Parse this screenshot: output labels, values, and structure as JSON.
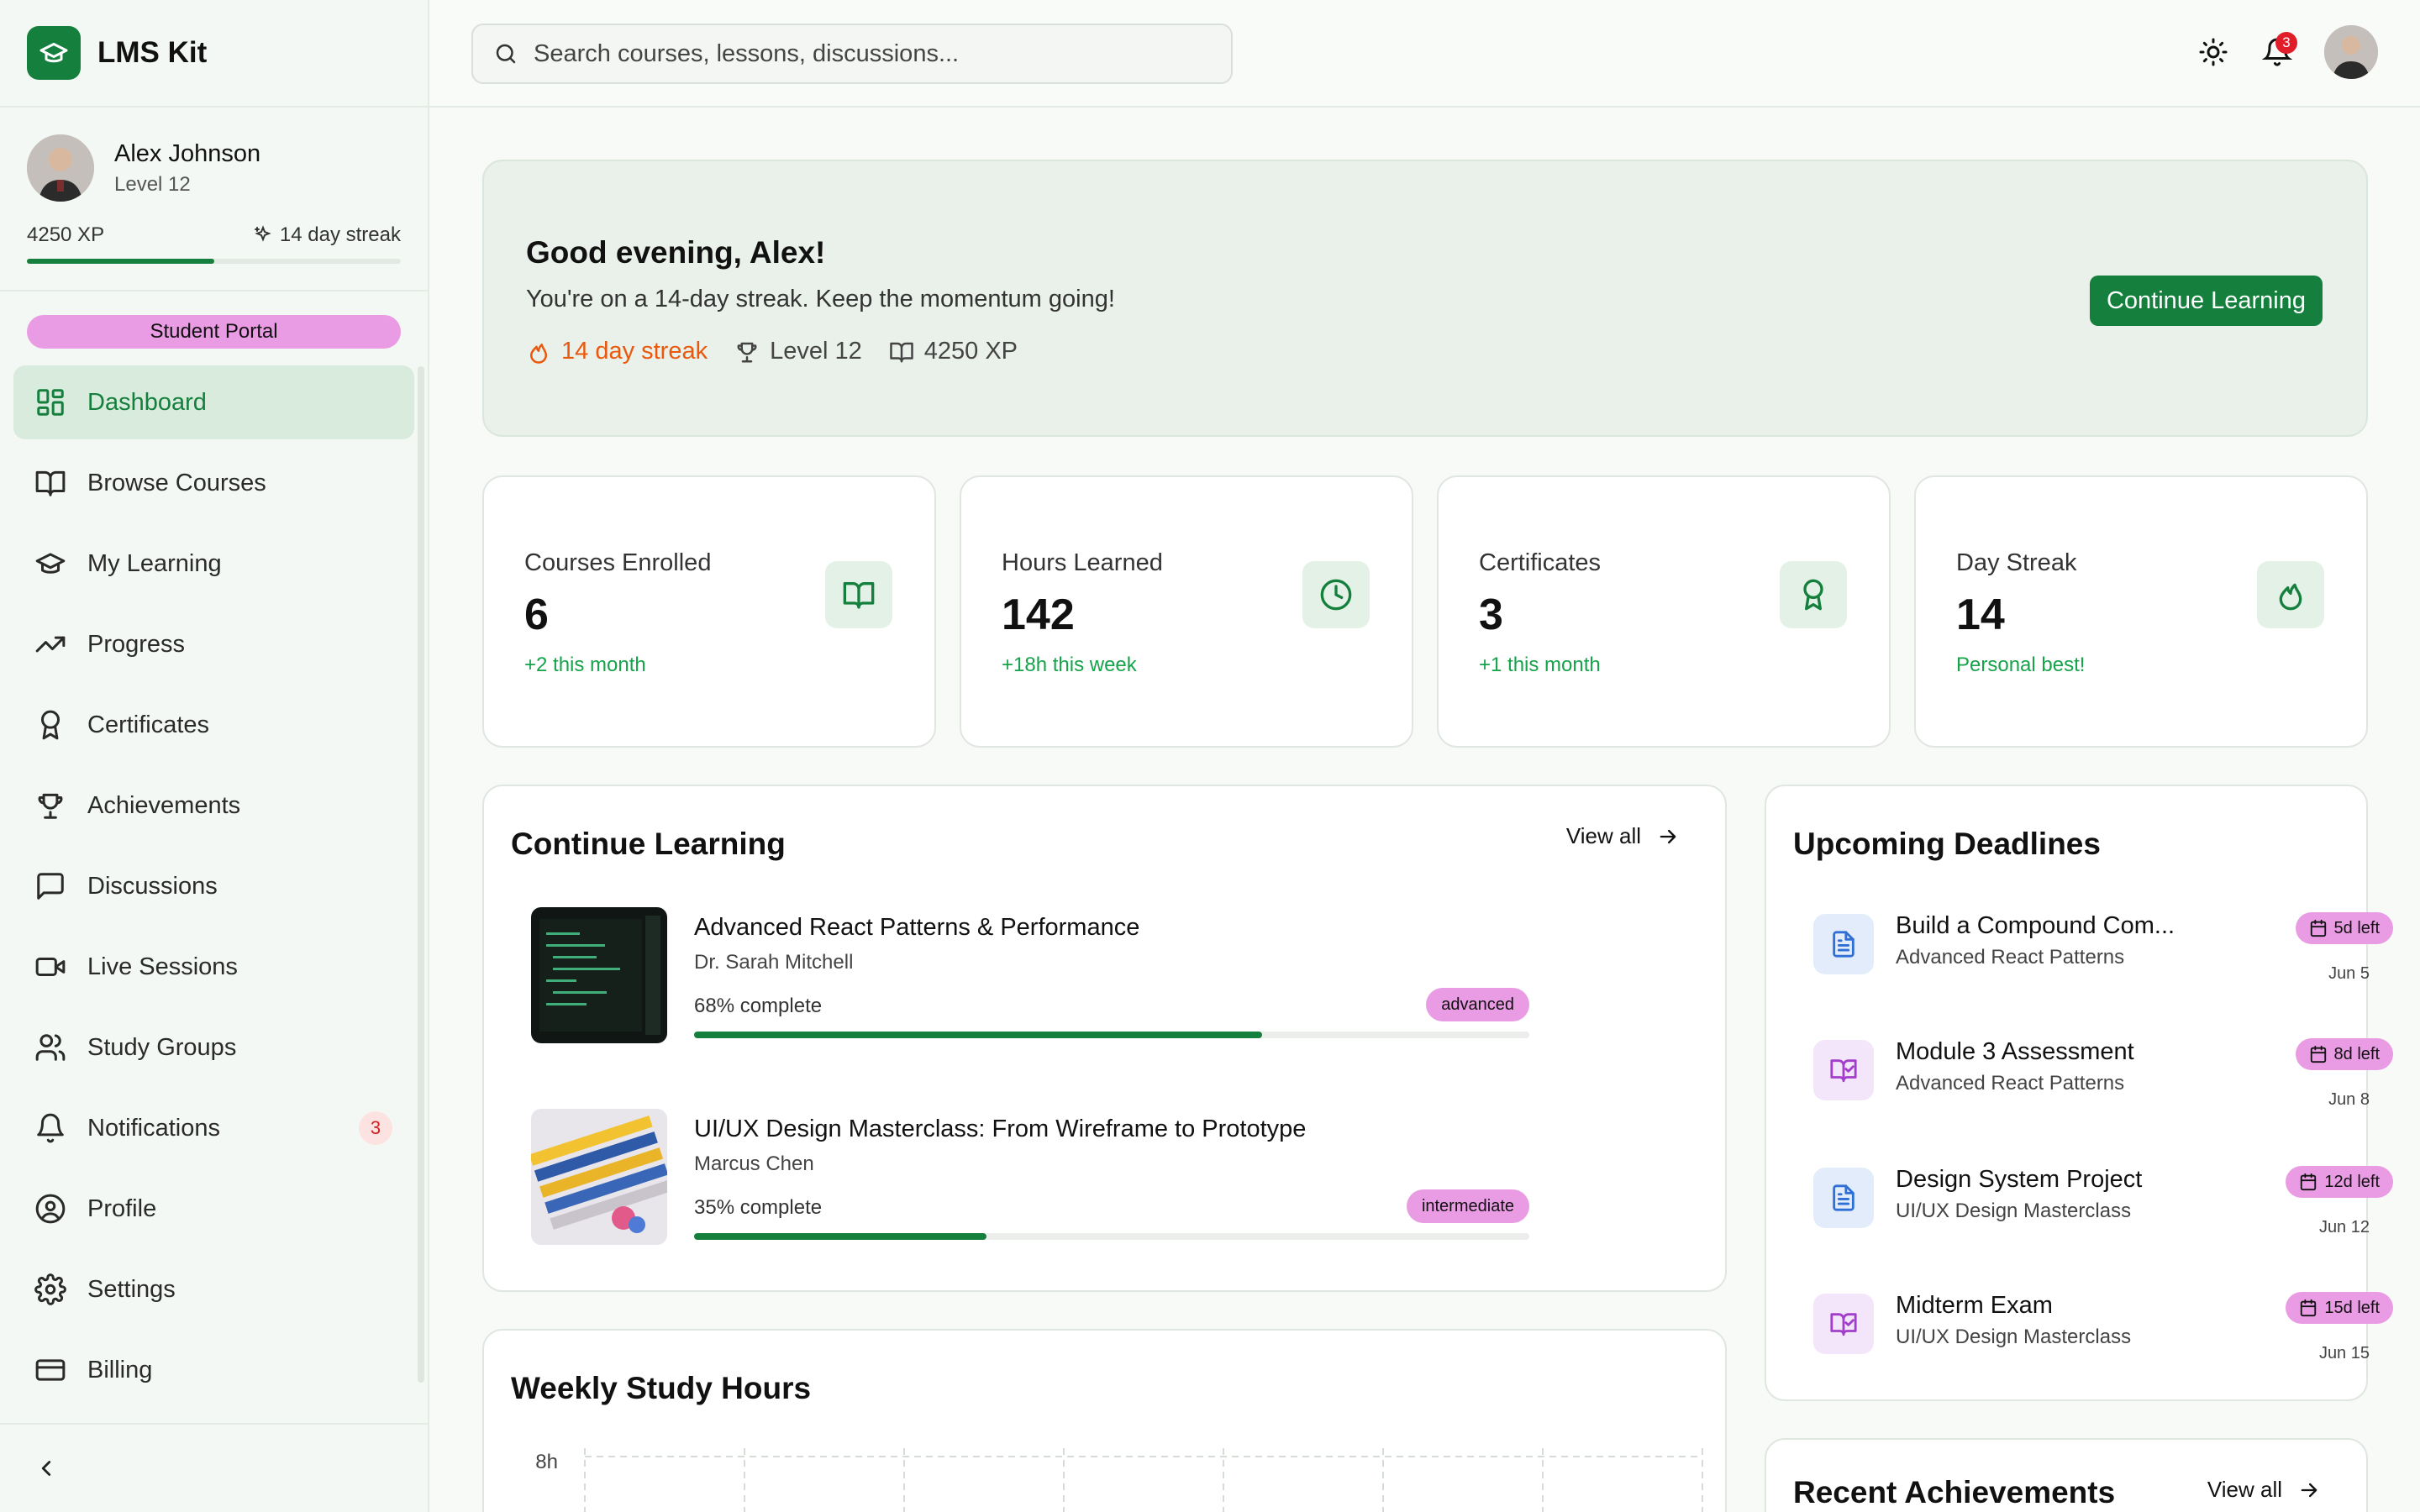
{
  "brand": {
    "name": "LMS Kit"
  },
  "user": {
    "name": "Alex Johnson",
    "level": "Level 12",
    "xp": "4250 XP",
    "streak": "14 day streak",
    "xp_progress": 0.5
  },
  "portal_badge": "Student Portal",
  "nav": [
    {
      "label": "Dashboard",
      "icon": "dashboard-icon",
      "active": true
    },
    {
      "label": "Browse Courses",
      "icon": "book-open-icon"
    },
    {
      "label": "My Learning",
      "icon": "graduation-cap-icon"
    },
    {
      "label": "Progress",
      "icon": "trending-up-icon"
    },
    {
      "label": "Certificates",
      "icon": "award-icon"
    },
    {
      "label": "Achievements",
      "icon": "trophy-icon"
    },
    {
      "label": "Discussions",
      "icon": "message-square-icon"
    },
    {
      "label": "Live Sessions",
      "icon": "video-icon"
    },
    {
      "label": "Study Groups",
      "icon": "users-icon"
    },
    {
      "label": "Notifications",
      "icon": "bell-icon",
      "badge": "3"
    },
    {
      "label": "Profile",
      "icon": "user-circle-icon"
    },
    {
      "label": "Settings",
      "icon": "gear-icon"
    },
    {
      "label": "Billing",
      "icon": "credit-card-icon"
    }
  ],
  "search": {
    "placeholder": "Search courses, lessons, discussions..."
  },
  "topbar": {
    "notification_count": "3"
  },
  "hero": {
    "greeting": "Good evening, Alex!",
    "subtitle": "You're on a 14-day streak. Keep the momentum going!",
    "streak": "14 day streak",
    "level": "Level 12",
    "xp": "4250 XP",
    "button": "Continue Learning"
  },
  "stats": [
    {
      "label": "Courses Enrolled",
      "value": "6",
      "delta": "+2 this month",
      "icon": "book-open-icon"
    },
    {
      "label": "Hours Learned",
      "value": "142",
      "delta": "+18h this week",
      "icon": "clock-icon"
    },
    {
      "label": "Certificates",
      "value": "3",
      "delta": "+1 this month",
      "icon": "award-icon"
    },
    {
      "label": "Day Streak",
      "value": "14",
      "delta": "Personal best!",
      "icon": "flame-icon"
    }
  ],
  "continue_learning": {
    "title": "Continue Learning",
    "view_all": "View all",
    "courses": [
      {
        "title": "Advanced React Patterns & Performance",
        "author": "Dr. Sarah Mitchell",
        "progress_text": "68% complete",
        "progress": 0.68,
        "tag": "advanced"
      },
      {
        "title": "UI/UX Design Masterclass: From Wireframe to Prototype",
        "author": "Marcus Chen",
        "progress_text": "35% complete",
        "progress": 0.35,
        "tag": "intermediate"
      }
    ]
  },
  "deadlines": {
    "title": "Upcoming Deadlines",
    "items": [
      {
        "title": "Build a Compound Com...",
        "course": "Advanced React Patterns",
        "left": "5d left",
        "date": "Jun 5",
        "icon": "file-text-icon",
        "color": "blue"
      },
      {
        "title": "Module 3 Assessment",
        "course": "Advanced React Patterns",
        "left": "8d left",
        "date": "Jun 8",
        "icon": "book-check-icon",
        "color": "purple"
      },
      {
        "title": "Design System Project",
        "course": "UI/UX Design Masterclass",
        "left": "12d left",
        "date": "Jun 12",
        "icon": "file-text-icon",
        "color": "blue"
      },
      {
        "title": "Midterm Exam",
        "course": "UI/UX Design Masterclass",
        "left": "15d left",
        "date": "Jun 15",
        "icon": "book-check-icon",
        "color": "purple"
      }
    ]
  },
  "weekly_study": {
    "title": "Weekly Study Hours",
    "y_tick_top": "8h"
  },
  "achievements": {
    "title": "Recent Achievements",
    "view_all": "View all"
  },
  "colors": {
    "brand_green": "#15803d",
    "accent_pink": "#e99be3",
    "streak_orange": "#ea580c",
    "badge_red": "#e11d2a"
  }
}
